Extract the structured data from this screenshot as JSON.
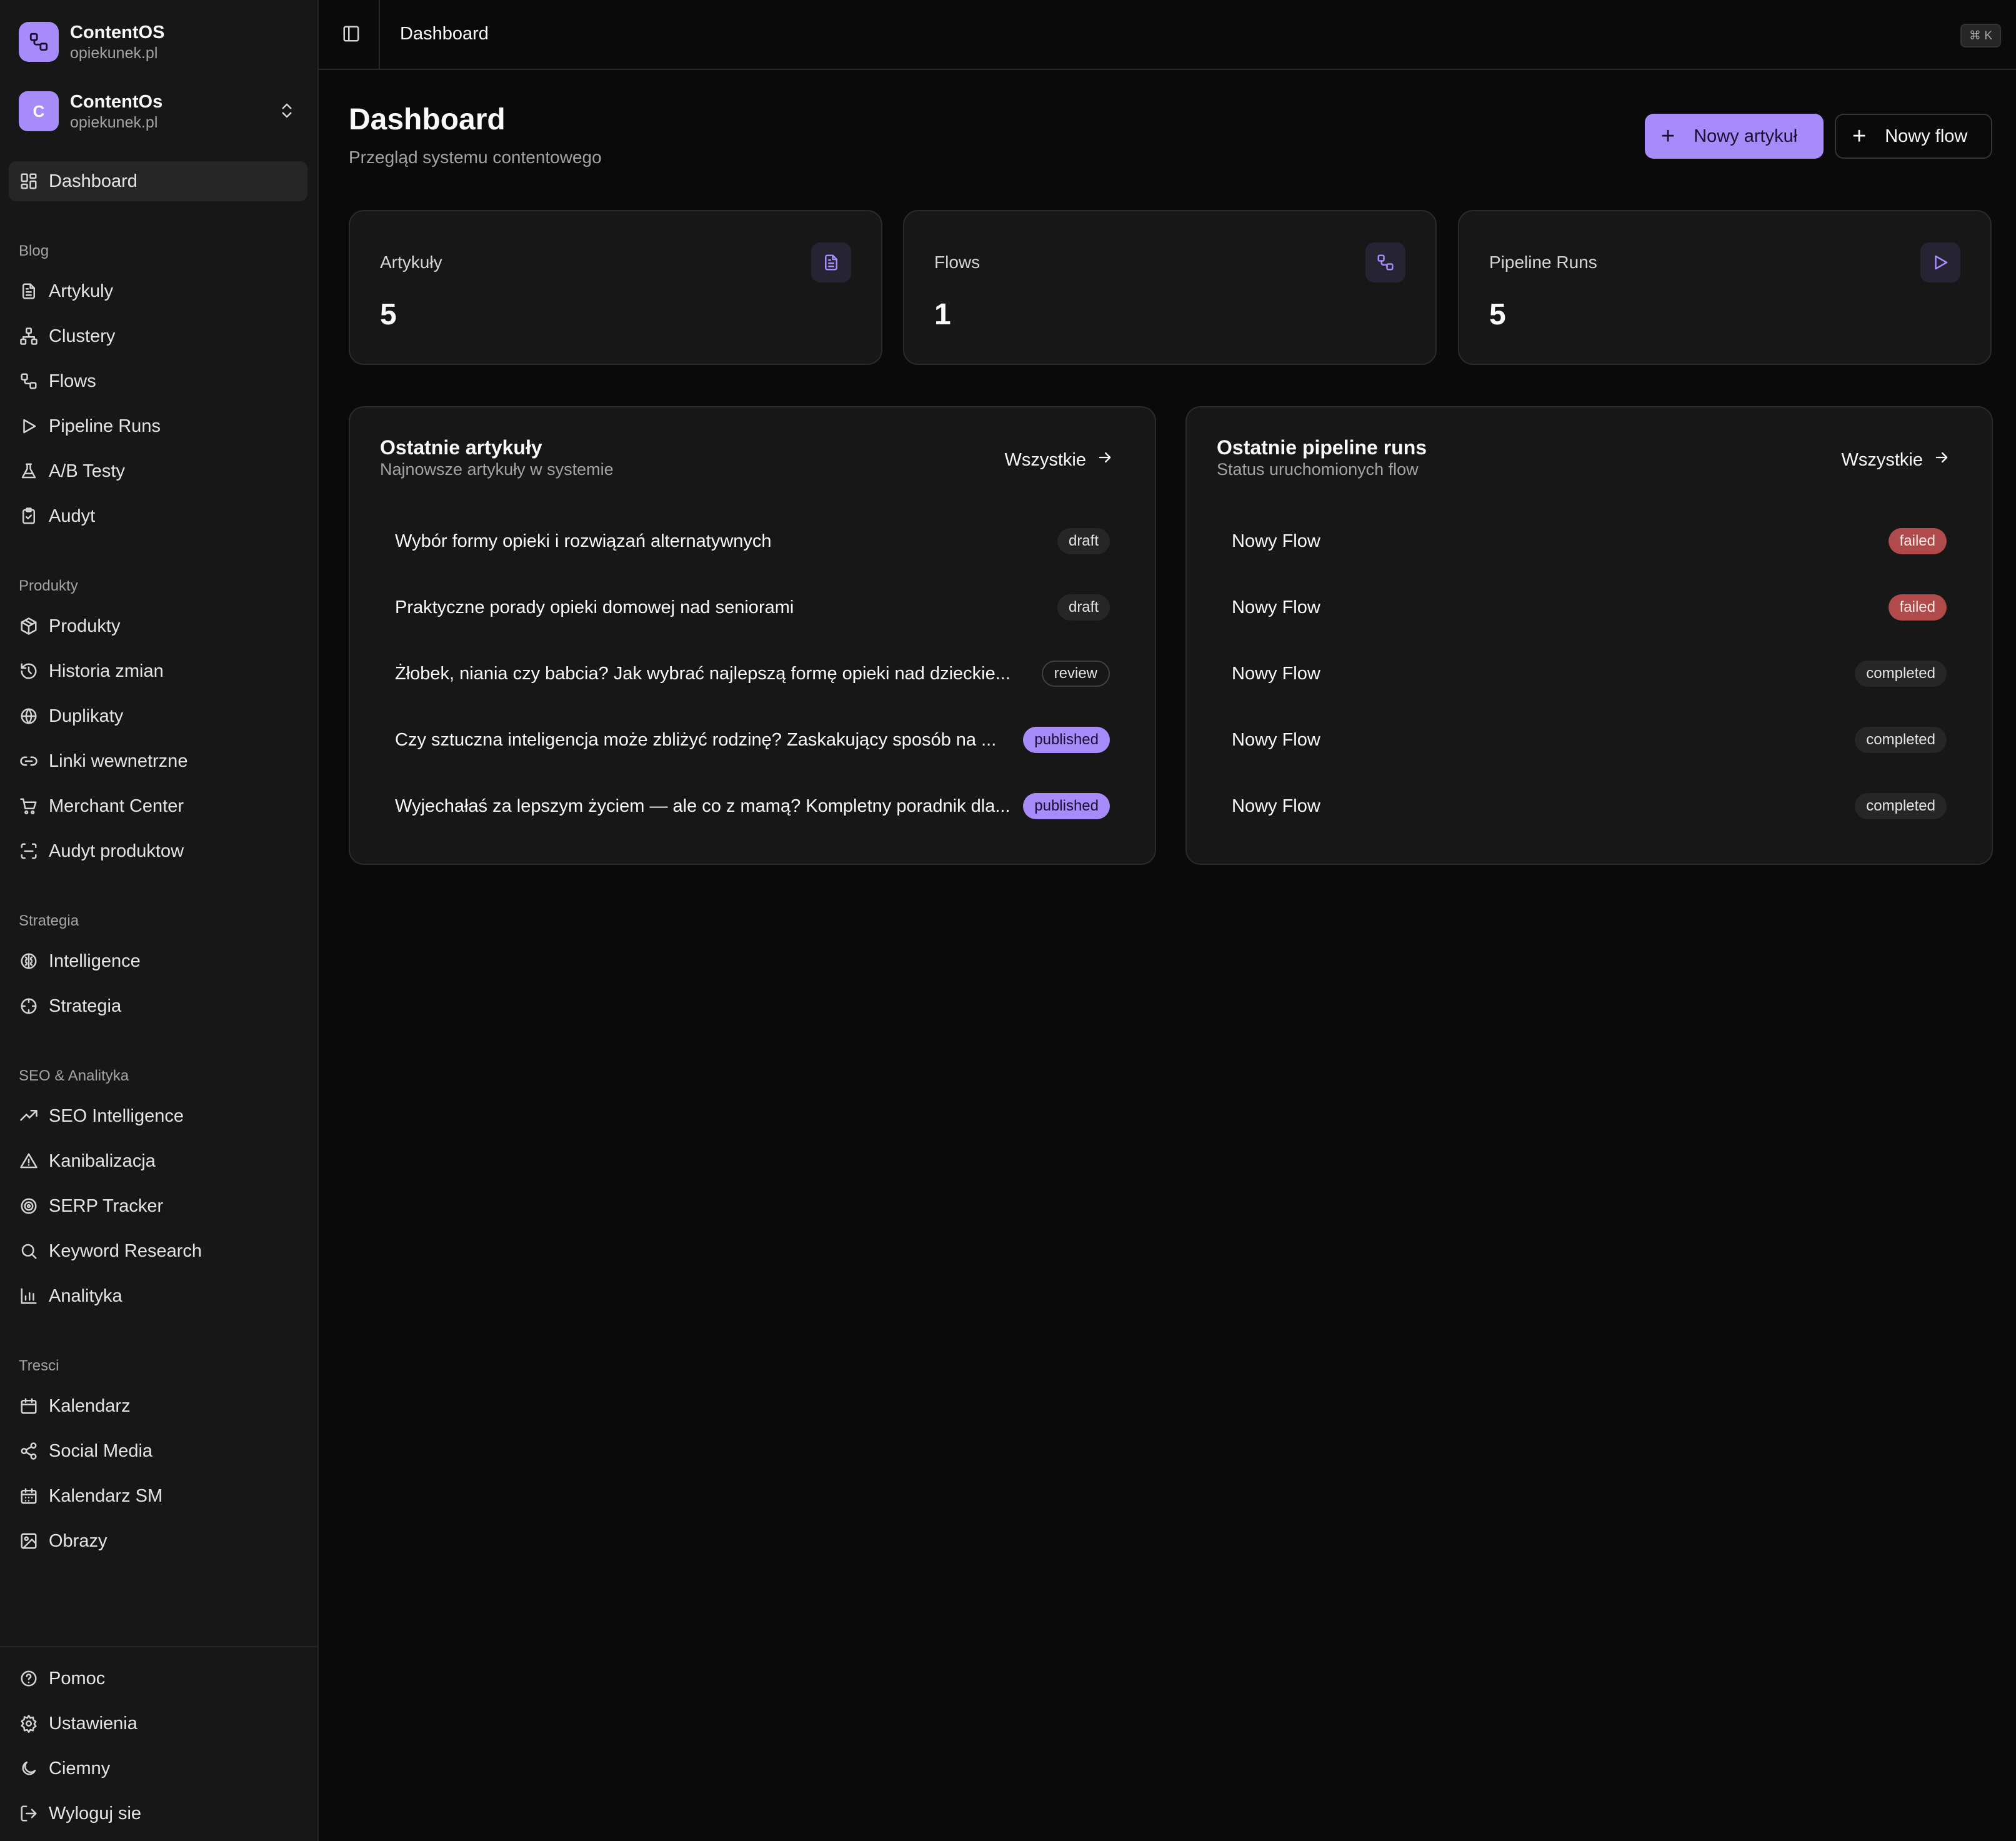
{
  "brand": {
    "title": "ContentOS",
    "domain": "opiekunek.pl"
  },
  "workspace": {
    "initial": "C",
    "name": "ContentOs",
    "domain": "opiekunek.pl"
  },
  "nav": {
    "dashboard": "Dashboard",
    "sections": {
      "blog": "Blog",
      "produkty": "Produkty",
      "strategia": "Strategia",
      "seo": "SEO & Analityka",
      "tresci": "Tresci"
    },
    "blog": [
      "Artykuly",
      "Clustery",
      "Flows",
      "Pipeline Runs",
      "A/B Testy",
      "Audyt"
    ],
    "produkty": [
      "Produkty",
      "Historia zmian",
      "Duplikaty",
      "Linki wewnetrzne",
      "Merchant Center",
      "Audyt produktow"
    ],
    "strategia": [
      "Intelligence",
      "Strategia"
    ],
    "seo": [
      "SEO Intelligence",
      "Kanibalizacja",
      "SERP Tracker",
      "Keyword Research",
      "Analityka"
    ],
    "tresci": [
      "Kalendarz",
      "Social Media",
      "Kalendarz SM",
      "Obrazy"
    ],
    "footer": [
      "Pomoc",
      "Ustawienia",
      "Ciemny",
      "Wyloguj sie"
    ]
  },
  "topbar": {
    "title": "Dashboard",
    "shortcut": "⌘ K"
  },
  "page": {
    "title": "Dashboard",
    "subtitle": "Przegląd systemu contentowego",
    "new_article": "Nowy artykuł",
    "new_flow": "Nowy flow"
  },
  "stats": [
    {
      "label": "Artykuły",
      "value": "5",
      "icon": "file-text-icon"
    },
    {
      "label": "Flows",
      "value": "1",
      "icon": "workflow-icon"
    },
    {
      "label": "Pipeline Runs",
      "value": "5",
      "icon": "play-icon"
    }
  ],
  "articles_panel": {
    "title": "Ostatnie artykuły",
    "subtitle": "Najnowsze artykuły w systemie",
    "link": "Wszystkie",
    "rows": [
      {
        "title": "Wybór formy opieki i rozwiązań alternatywnych",
        "status": "draft"
      },
      {
        "title": "Praktyczne porady opieki domowej nad seniorami",
        "status": "draft"
      },
      {
        "title": "Żłobek, niania czy babcia? Jak wybrać najlepszą formę opieki nad dzieckie...",
        "status": "review"
      },
      {
        "title": "Czy sztuczna inteligencja może zbliżyć rodzinę? Zaskakujący sposób na ...",
        "status": "published"
      },
      {
        "title": "Wyjechałaś za lepszym życiem — ale co z mamą? Kompletny poradnik dla...",
        "status": "published"
      }
    ]
  },
  "runs_panel": {
    "title": "Ostatnie pipeline runs",
    "subtitle": "Status uruchomionych flow",
    "link": "Wszystkie",
    "rows": [
      {
        "title": "Nowy Flow",
        "status": "failed"
      },
      {
        "title": "Nowy Flow",
        "status": "failed"
      },
      {
        "title": "Nowy Flow",
        "status": "completed"
      },
      {
        "title": "Nowy Flow",
        "status": "completed"
      },
      {
        "title": "Nowy Flow",
        "status": "completed"
      }
    ]
  },
  "colors": {
    "accent": "#a78bfa",
    "background": "#0a0a0a",
    "card": "#171717",
    "failed": "#b14a4a"
  }
}
